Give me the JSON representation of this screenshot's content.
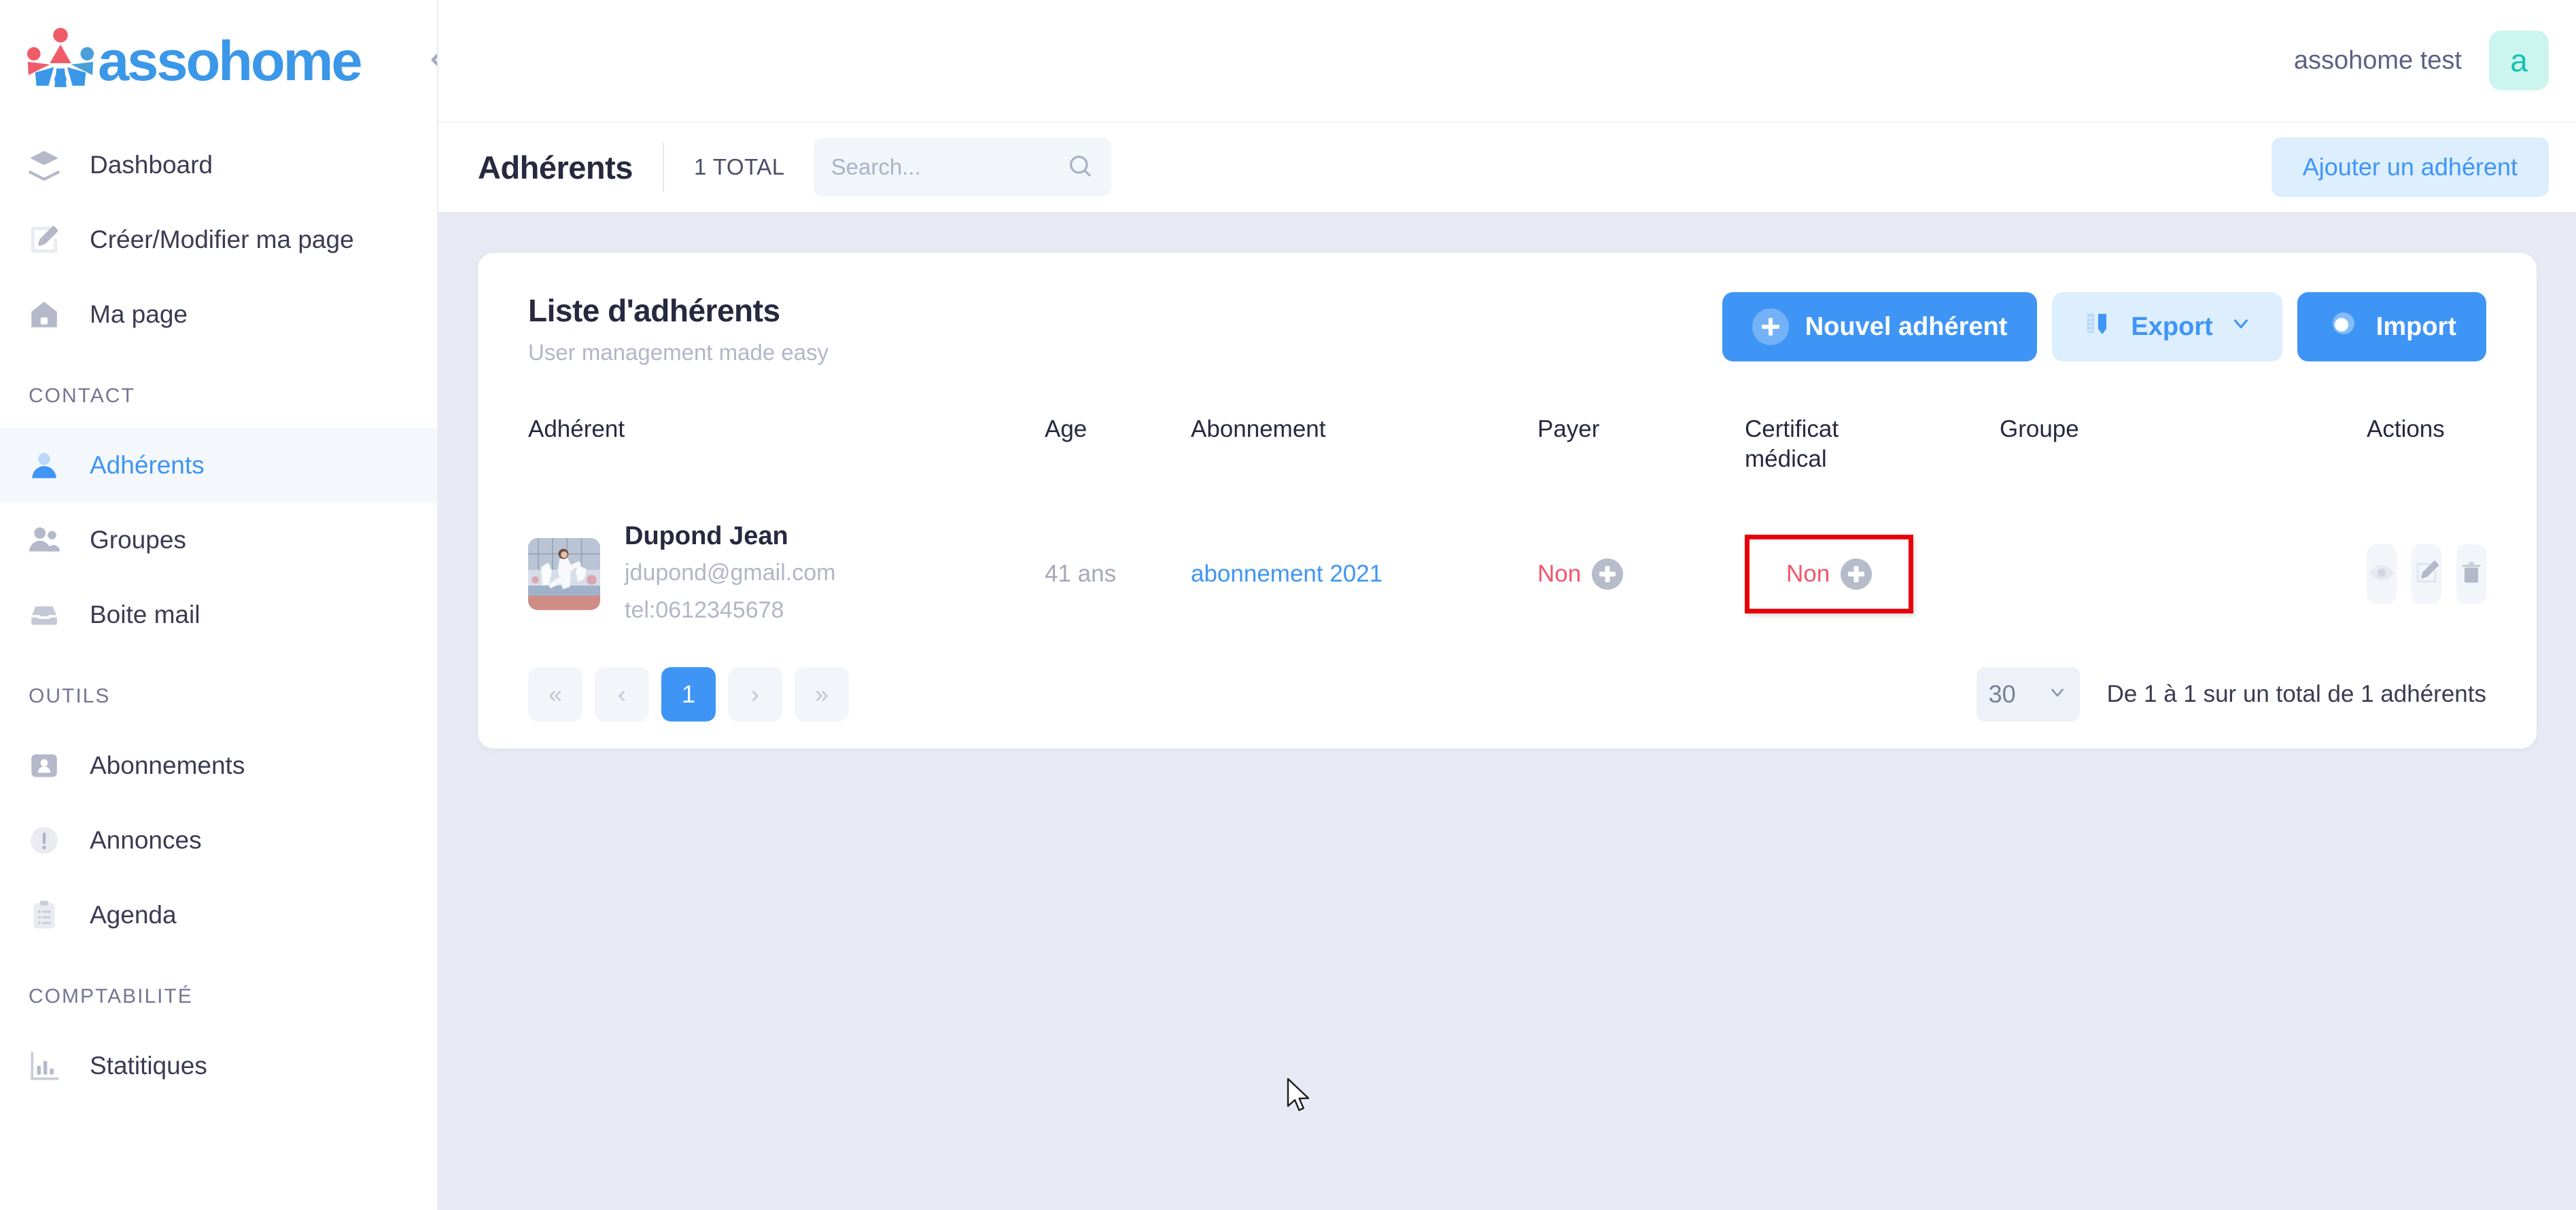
{
  "brand": {
    "name": "assohome",
    "collapse_icon": "chevron-double-left-icon"
  },
  "topbar": {
    "user_name": "assohome test",
    "avatar_initial": "a"
  },
  "subbar": {
    "title": "Adhérents",
    "total": "1 TOTAL",
    "search_placeholder": "Search...",
    "search_value": "",
    "search_icon": "search-icon",
    "add_button": "Ajouter un adhérent"
  },
  "sidebar": {
    "items": [
      {
        "label": "Dashboard",
        "icon": "layers-icon",
        "active": false
      },
      {
        "label": "Créer/Modifier ma page",
        "icon": "edit-square-icon",
        "active": false
      },
      {
        "label": "Ma page",
        "icon": "home-icon",
        "active": false
      }
    ],
    "sections": [
      {
        "title": "CONTACT",
        "items": [
          {
            "label": "Adhérents",
            "icon": "user-icon",
            "active": true
          },
          {
            "label": "Groupes",
            "icon": "users-icon",
            "active": false
          },
          {
            "label": "Boite mail",
            "icon": "inbox-icon",
            "active": false
          }
        ]
      },
      {
        "title": "OUTILS",
        "items": [
          {
            "label": "Abonnements",
            "icon": "id-card-icon",
            "active": false
          },
          {
            "label": "Annonces",
            "icon": "alert-circle-icon",
            "active": false
          },
          {
            "label": "Agenda",
            "icon": "clipboard-list-icon",
            "active": false
          }
        ]
      },
      {
        "title": "COMPTABILITÉ",
        "items": [
          {
            "label": "Statitiques",
            "icon": "bar-chart-icon",
            "active": false
          }
        ]
      }
    ]
  },
  "card": {
    "title": "Liste d'adhérents",
    "subtitle": "User management made easy",
    "buttons": {
      "new": "Nouvel adhérent",
      "export": "Export",
      "import": "Import"
    }
  },
  "table": {
    "headers": {
      "adherent": "Adhérent",
      "age": "Age",
      "abonnement": "Abonnement",
      "payer": "Payer",
      "certificat_line1": "Certificat",
      "certificat_line2": "médical",
      "groupe": "Groupe",
      "actions": "Actions"
    },
    "rows": [
      {
        "name": "Dupond Jean",
        "email": "jdupond@gmail.com",
        "phone": "tel:0612345678",
        "age": "41 ans",
        "abonnement": "abonnement 2021",
        "payer": "Non",
        "certificat": "Non",
        "groupe": "",
        "avatar_alt": "member-photo"
      }
    ]
  },
  "pagination": {
    "first": "«",
    "prev": "‹",
    "current": "1",
    "next": "›",
    "last": "»",
    "page_size": "30",
    "range_text": "De 1 à 1 sur un total de 1 adhérents"
  },
  "colors": {
    "accent": "#3f95f5",
    "accent_light": "#ddeefe",
    "danger": "#f4546a",
    "highlight": "#e8000d",
    "avatar_bg": "#cdf5ef",
    "avatar_fg": "#14c2b2",
    "page_bg": "#e7eaf4"
  }
}
